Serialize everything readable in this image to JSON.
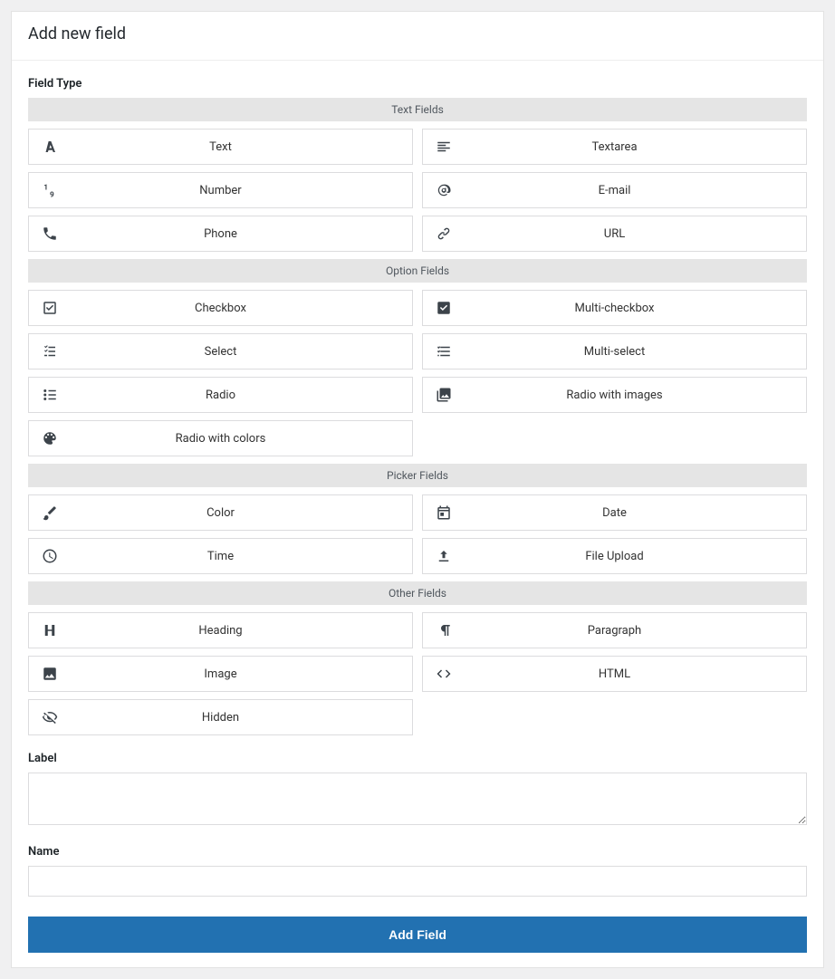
{
  "title": "Add new field",
  "labels": {
    "field_type": "Field Type",
    "label_input": "Label",
    "name_input": "Name"
  },
  "groups": [
    {
      "header": "Text Fields",
      "items": [
        {
          "id": "text",
          "label": "Text",
          "icon": "font"
        },
        {
          "id": "textarea",
          "label": "Textarea",
          "icon": "align-left"
        },
        {
          "id": "number",
          "label": "Number",
          "icon": "one-nine"
        },
        {
          "id": "email",
          "label": "E-mail",
          "icon": "at"
        },
        {
          "id": "phone",
          "label": "Phone",
          "icon": "phone"
        },
        {
          "id": "url",
          "label": "URL",
          "icon": "link"
        }
      ]
    },
    {
      "header": "Option Fields",
      "items": [
        {
          "id": "checkbox",
          "label": "Checkbox",
          "icon": "check-square"
        },
        {
          "id": "multi-checkbox",
          "label": "Multi-checkbox",
          "icon": "check-square-fill"
        },
        {
          "id": "select",
          "label": "Select",
          "icon": "list-check"
        },
        {
          "id": "multi-select",
          "label": "Multi-select",
          "icon": "list-checks"
        },
        {
          "id": "radio",
          "label": "Radio",
          "icon": "list-bullets"
        },
        {
          "id": "radio-images",
          "label": "Radio with images",
          "icon": "images"
        },
        {
          "id": "radio-colors",
          "label": "Radio with colors",
          "icon": "palette",
          "half": true
        }
      ]
    },
    {
      "header": "Picker Fields",
      "items": [
        {
          "id": "color",
          "label": "Color",
          "icon": "brush"
        },
        {
          "id": "date",
          "label": "Date",
          "icon": "calendar"
        },
        {
          "id": "time",
          "label": "Time",
          "icon": "clock"
        },
        {
          "id": "file-upload",
          "label": "File Upload",
          "icon": "upload"
        }
      ]
    },
    {
      "header": "Other Fields",
      "items": [
        {
          "id": "heading",
          "label": "Heading",
          "icon": "heading"
        },
        {
          "id": "paragraph",
          "label": "Paragraph",
          "icon": "pilcrow"
        },
        {
          "id": "image",
          "label": "Image",
          "icon": "image"
        },
        {
          "id": "html",
          "label": "HTML",
          "icon": "code"
        },
        {
          "id": "hidden",
          "label": "Hidden",
          "icon": "eye-off",
          "half": true
        }
      ]
    }
  ],
  "form": {
    "label_value": "",
    "name_value": ""
  },
  "submit_label": "Add Field",
  "colors": {
    "primary": "#2271b1"
  }
}
